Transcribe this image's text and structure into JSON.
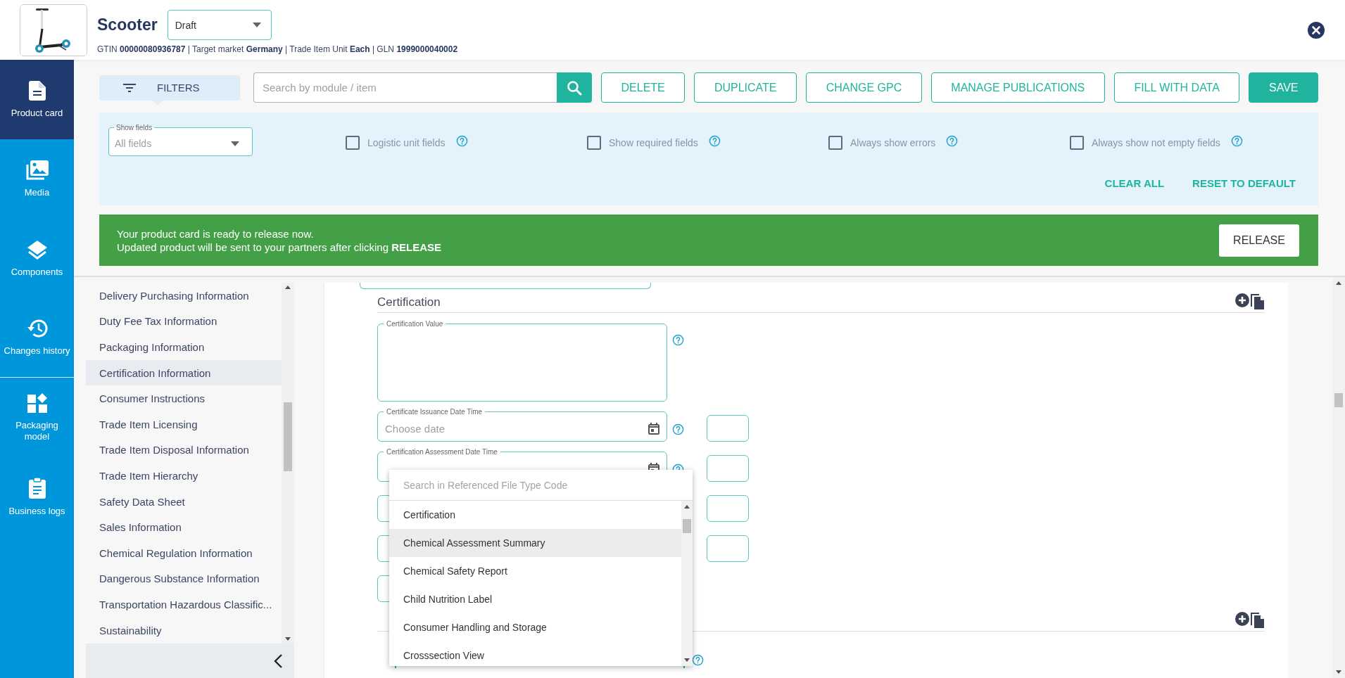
{
  "product": {
    "title": "Scooter",
    "status": "Draft",
    "meta": "GTIN **00000080936787** | Target market **Germany** | Trade Item Unit **Each** | GLN **1999000040002**"
  },
  "nav": [
    {
      "label": "Product card",
      "selected": true
    },
    {
      "label": "Media",
      "selected": false
    },
    {
      "label": "Components",
      "selected": false
    },
    {
      "label": "Changes history",
      "selected": false
    },
    {
      "label": "Packaging model",
      "selected": false
    },
    {
      "label": "Business logs",
      "selected": false
    }
  ],
  "toolbar": {
    "filters": "FILTERS",
    "search": {
      "placeholder": "Search by module / item"
    },
    "buttons": [
      {
        "label": "DELETE",
        "kind": "outline"
      },
      {
        "label": "DUPLICATE",
        "kind": "outline"
      },
      {
        "label": "CHANGE GPC",
        "kind": "outline"
      },
      {
        "label": "MANAGE PUBLICATIONS",
        "kind": "outline"
      },
      {
        "label": "FILL WITH DATA",
        "kind": "outline"
      },
      {
        "label": "SAVE",
        "kind": "primary"
      }
    ]
  },
  "filters": {
    "show_fields": {
      "label": "Show fields",
      "placeholder": "All fields"
    },
    "checkboxes": [
      {
        "label": "Logistic unit fields",
        "checked": false
      },
      {
        "label": "Show required fields",
        "checked": false
      },
      {
        "label": "Always show errors",
        "checked": false
      },
      {
        "label": "Always show not empty fields",
        "checked": false
      }
    ],
    "actions": [
      "CLEAR ALL",
      "RESET TO DEFAULT"
    ]
  },
  "banner": {
    "lines": [
      "Your product card is ready to release now.",
      "Updated product will be sent to your partners after clicking **RELEASE**"
    ],
    "button": "RELEASE"
  },
  "modules": [
    {
      "label": "Delivery Purchasing Information",
      "selected": false
    },
    {
      "label": "Duty Fee Tax Information",
      "selected": false
    },
    {
      "label": "Packaging Information",
      "selected": false
    },
    {
      "label": "Certification Information",
      "selected": true
    },
    {
      "label": "Consumer Instructions",
      "selected": false
    },
    {
      "label": "Trade Item Licensing",
      "selected": false
    },
    {
      "label": "Trade Item Disposal Information",
      "selected": false
    },
    {
      "label": "Trade Item Hierarchy",
      "selected": false
    },
    {
      "label": "Safety Data Sheet",
      "selected": false
    },
    {
      "label": "Sales Information",
      "selected": false
    },
    {
      "label": "Chemical Regulation Information",
      "selected": false
    },
    {
      "label": "Dangerous Substance Information",
      "selected": false
    },
    {
      "label": "Transportation Hazardous Classific...",
      "selected": false
    },
    {
      "label": "Sustainability",
      "selected": false
    }
  ],
  "form": {
    "section": "Certification",
    "fields": [
      {
        "kind": "textarea",
        "label": "Certification Value",
        "side_box": false
      },
      {
        "kind": "date",
        "label": "Certificate Issuance Date Time",
        "placeholder": "Choose date",
        "side_box": true
      },
      {
        "kind": "date",
        "label": "Certification Assessment Date Time",
        "side_box": true
      },
      {
        "kind": "covered",
        "side_box": true
      },
      {
        "kind": "covered",
        "side_box": true
      },
      {
        "kind": "covered",
        "side_box": false
      }
    ]
  },
  "dropdown": {
    "placeholder": "Search in Referenced File Type Code",
    "options": [
      {
        "label": "Certification",
        "selected": false
      },
      {
        "label": "Chemical Assessment Summary",
        "selected": true
      },
      {
        "label": "Chemical Safety Report",
        "selected": false
      },
      {
        "label": "Child Nutrition Label",
        "selected": false
      },
      {
        "label": "Consumer Handling and Storage",
        "selected": false
      },
      {
        "label": "Crosssection View",
        "selected": false
      }
    ]
  }
}
